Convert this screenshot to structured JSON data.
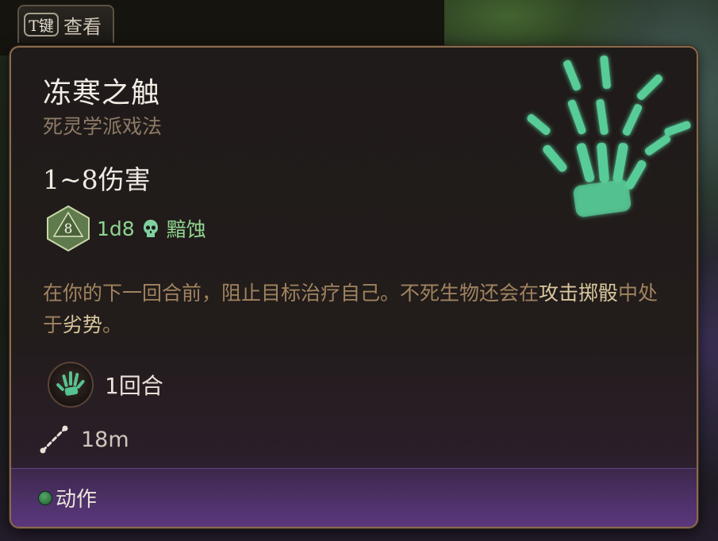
{
  "hint": {
    "key": "T键",
    "label": "查看"
  },
  "spell": {
    "name": "冻寒之触",
    "school": "死灵学派戏法",
    "damage": "1~8伤害",
    "dice": {
      "face": "8",
      "roll": "1d8",
      "damage_type": "黯蚀",
      "damage_type_icon": "skull-icon"
    },
    "description": {
      "part1": "在你的下一回合前，阻止目标治疗自己。不死生物还会在",
      "highlight1": "攻击掷骰",
      "part2": "中处于",
      "highlight2": "劣势",
      "part3": "。"
    },
    "duration": "1回合",
    "range": "18m",
    "cost": "动作"
  },
  "colors": {
    "accent_green": "#8fd48f",
    "border_gold": "#8a6a4c",
    "footer_purple": "#5a3a84"
  }
}
